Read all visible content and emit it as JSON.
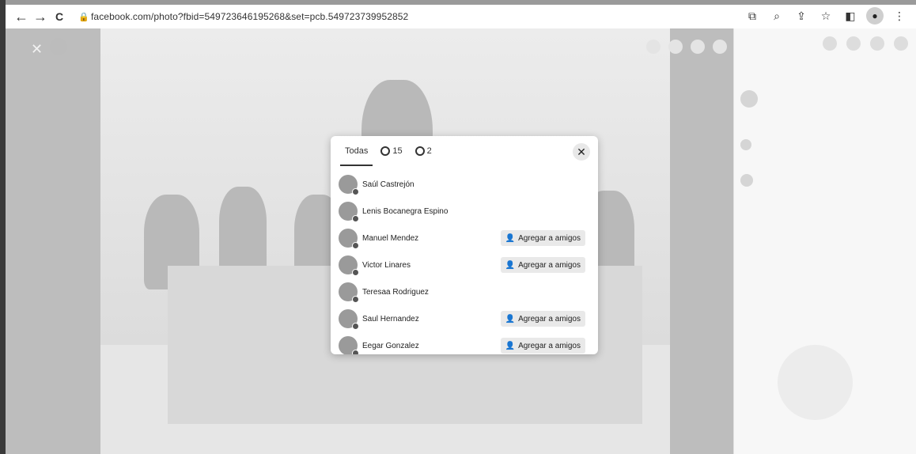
{
  "browser": {
    "url": "facebook.com/photo?fbid=549723646195268&set=pcb.549723739952852",
    "back_icon": "←",
    "forward_icon": "→",
    "reload_icon": "C",
    "lock_icon": "🔒",
    "toolbar_icons": [
      "⧉",
      "⌕",
      "⇪",
      "☆",
      "◧",
      "●",
      "⋮"
    ]
  },
  "viewer": {
    "close_icon": "✕"
  },
  "modal": {
    "tabs": [
      {
        "label": "Todas",
        "active": true
      },
      {
        "label": "15",
        "icon": "like"
      },
      {
        "label": "2",
        "icon": "love"
      }
    ],
    "close_icon": "✕",
    "add_friend_label": "Agregar a amigos",
    "add_friend_icon": "👤",
    "people": [
      {
        "name": "Saúl Castrejón",
        "show_add": false
      },
      {
        "name": "Lenis Bocanegra Espino",
        "show_add": false
      },
      {
        "name": "Manuel Mendez",
        "show_add": true
      },
      {
        "name": "Victor Linares",
        "show_add": true
      },
      {
        "name": "Teresaa Rodriguez",
        "show_add": false
      },
      {
        "name": "Saul Hernandez",
        "show_add": true
      },
      {
        "name": "Eegar Gonzalez",
        "show_add": true
      }
    ]
  },
  "colors": {
    "modal_bg": "#ffffff",
    "overlay": "#c9c9c9"
  }
}
